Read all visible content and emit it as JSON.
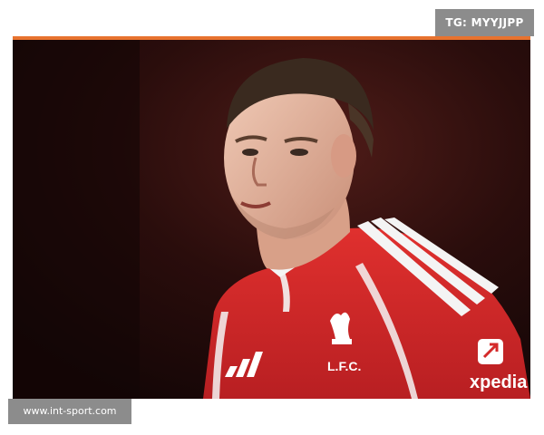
{
  "watermarks": {
    "top_right": "TG: MYYJJPP",
    "bottom_left": "www.int-sport.com"
  },
  "photo": {
    "subject": "Footballer in red Liverpool home kit with crest and sponsor logos against a dark stadium background",
    "crest_text": "L.F.C.",
    "sponsor_text": "xpedia",
    "colors": {
      "accent_rule": "#e8732f",
      "kit_red": "#d42a2a",
      "background_dark": "#1c0909",
      "badge_gray": "#8c8c8c"
    }
  }
}
